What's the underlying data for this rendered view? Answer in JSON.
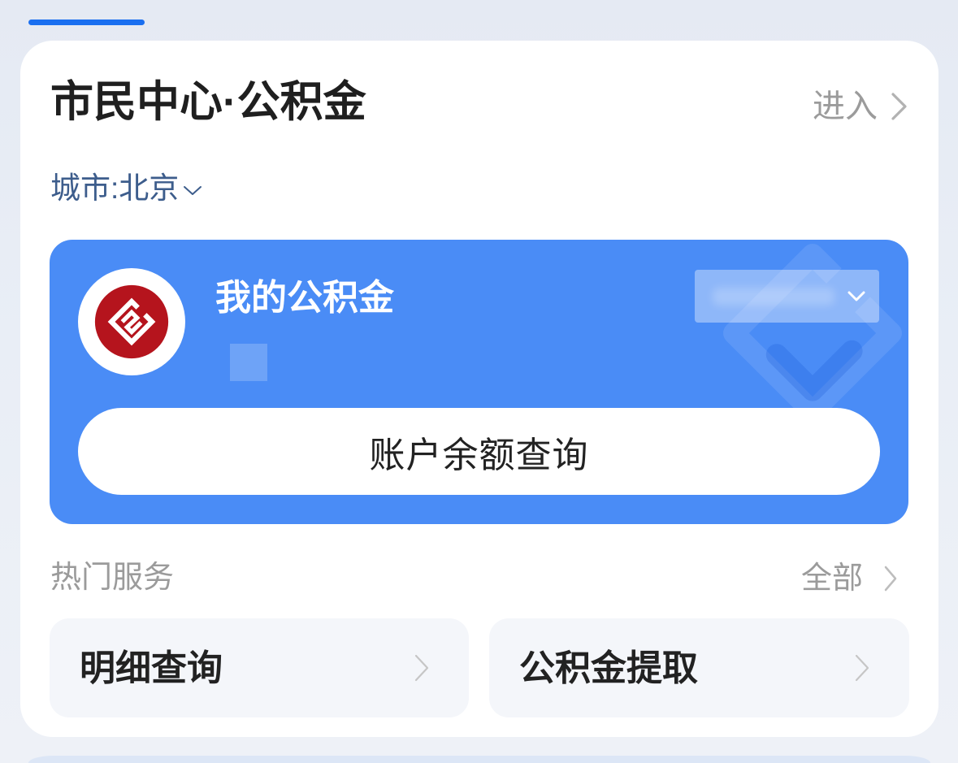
{
  "colors": {
    "page_background": "#e9eef6",
    "tab_indicator": "#1a6ff0",
    "fund_card_blue": "#4a8cf6",
    "logo_red": "#b5141d",
    "title_text": "#1f1f1f",
    "muted_text": "#9b9b9b",
    "city_text": "#3d5d8c",
    "tile_background": "#f4f6fa",
    "chevron_gray": "#bdbdbd"
  },
  "header": {
    "title": "市民中心·公积金",
    "enter_label": "进入",
    "enter_icon": "chevron-right-icon",
    "city_label": "城市:北京",
    "city_icon": "chevron-down-icon"
  },
  "fund_card": {
    "logo_icon": "housing-fund-logo-icon",
    "title": "我的公积金",
    "account_selector_icon": "chevron-down-icon",
    "balance_button_label": "账户余额查询"
  },
  "hot_services": {
    "title": "热门服务",
    "all_label": "全部",
    "all_icon": "chevron-right-icon",
    "items": [
      {
        "label": "明细查询",
        "icon": "chevron-right-icon"
      },
      {
        "label": "公积金提取",
        "icon": "chevron-right-icon"
      }
    ]
  }
}
